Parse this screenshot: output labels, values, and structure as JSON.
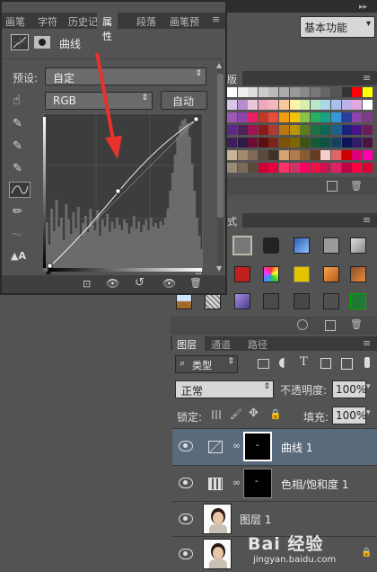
{
  "top_tabs": [
    "画笔",
    "字符",
    "历史记",
    "属性",
    "段落",
    "画笔预"
  ],
  "properties": {
    "title": "曲线",
    "preset_label": "预设:",
    "preset_value": "自定",
    "channel_value": "RGB",
    "auto_button": "自动"
  },
  "right_top": {
    "workspace": "基本功能",
    "swatches_tab": "版",
    "styles_tab": "式"
  },
  "layers": {
    "tabs": [
      "图层",
      "通道",
      "路径"
    ],
    "filter_type": "类型",
    "blend_mode": "正常",
    "opacity_label": "不透明度:",
    "opacity_value": "100%",
    "lock_label": "锁定:",
    "fill_label": "填充:",
    "fill_value": "100%",
    "rows": [
      {
        "name": "曲线 1"
      },
      {
        "name": "色相/饱和度 1"
      },
      {
        "name": "图层 1"
      },
      {
        "name": ""
      }
    ]
  },
  "watermark": {
    "line1": "Bai 经验",
    "line2": "jingyan.baidu.com"
  },
  "colors": {
    "accent_arrow": "#e8322b",
    "selected_row": "#596a7d"
  }
}
